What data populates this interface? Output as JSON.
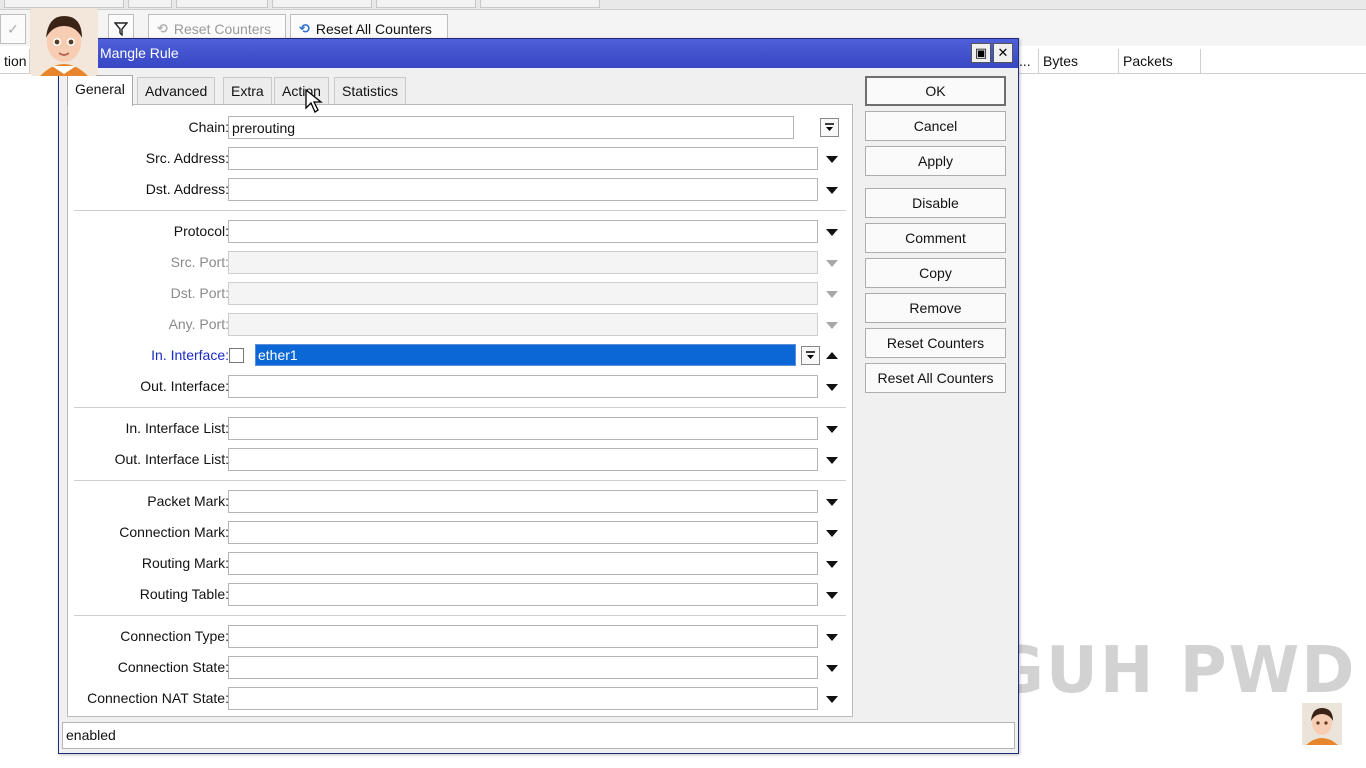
{
  "background": {
    "toolbar": {
      "reset_counters": "Reset Counters",
      "reset_all_counters": "Reset All Counters"
    },
    "columns": [
      "tion",
      "...",
      "Bytes",
      "Packets"
    ],
    "watermark": "TEGUH PWD"
  },
  "dialog": {
    "title": "Mangle Rule",
    "tabs": [
      "General",
      "Advanced",
      "Extra",
      "Action",
      "Statistics"
    ],
    "fields": {
      "chain": {
        "label": "Chain:",
        "value": "prerouting"
      },
      "src_address": {
        "label": "Src. Address:",
        "value": ""
      },
      "dst_address": {
        "label": "Dst. Address:",
        "value": ""
      },
      "protocol": {
        "label": "Protocol:",
        "value": ""
      },
      "src_port": {
        "label": "Src. Port:",
        "value": ""
      },
      "dst_port": {
        "label": "Dst. Port:",
        "value": ""
      },
      "any_port": {
        "label": "Any. Port:",
        "value": ""
      },
      "in_interface": {
        "label": "In. Interface:",
        "value": "ether1"
      },
      "out_interface": {
        "label": "Out. Interface:",
        "value": ""
      },
      "in_interface_list": {
        "label": "In. Interface List:",
        "value": ""
      },
      "out_interface_list": {
        "label": "Out. Interface List:",
        "value": ""
      },
      "packet_mark": {
        "label": "Packet Mark:",
        "value": ""
      },
      "connection_mark": {
        "label": "Connection Mark:",
        "value": ""
      },
      "routing_mark": {
        "label": "Routing Mark:",
        "value": ""
      },
      "routing_table": {
        "label": "Routing Table:",
        "value": ""
      },
      "connection_type": {
        "label": "Connection Type:",
        "value": ""
      },
      "connection_state": {
        "label": "Connection State:",
        "value": ""
      },
      "connection_nat_state": {
        "label": "Connection NAT State:",
        "value": ""
      }
    },
    "buttons": {
      "ok": "OK",
      "cancel": "Cancel",
      "apply": "Apply",
      "disable": "Disable",
      "comment": "Comment",
      "copy": "Copy",
      "remove": "Remove",
      "reset_counters": "Reset Counters",
      "reset_all_counters": "Reset All Counters"
    },
    "status": "enabled"
  },
  "colors": {
    "titlebar": "#3f50cc",
    "selection": "#0b66d6",
    "label_highlight": "#1a2ac8"
  }
}
